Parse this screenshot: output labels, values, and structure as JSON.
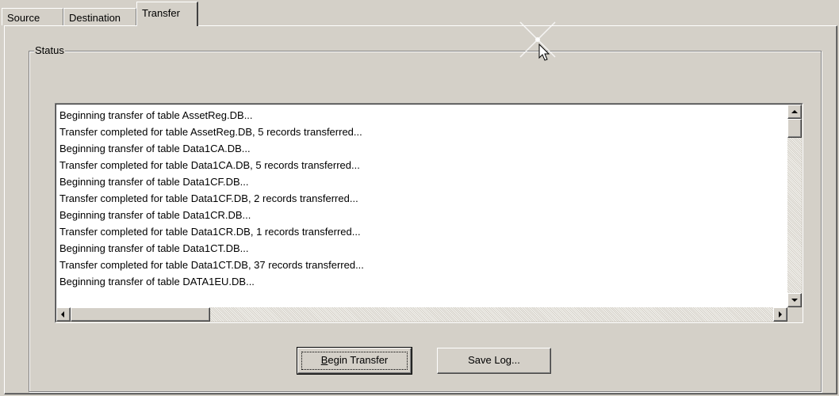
{
  "tabs": [
    {
      "label": "Source"
    },
    {
      "label": "Destination"
    },
    {
      "label": "Transfer"
    }
  ],
  "status_group": {
    "label": "Status"
  },
  "log": {
    "lines": [
      "Beginning transfer of table AssetReg.DB...",
      "Transfer completed for table AssetReg.DB, 5 records transferred...",
      "Beginning transfer of table Data1CA.DB...",
      "Transfer completed for table Data1CA.DB, 5 records transferred...",
      "Beginning transfer of table Data1CF.DB...",
      "Transfer completed for table Data1CF.DB, 2 records transferred...",
      "Beginning transfer of table Data1CR.DB...",
      "Transfer completed for table Data1CR.DB, 1 records transferred...",
      "Beginning transfer of table Data1CT.DB...",
      "Transfer completed for table Data1CT.DB, 37 records transferred...",
      "Beginning transfer of table DATA1EU.DB..."
    ]
  },
  "buttons": {
    "begin_transfer": {
      "accel": "B",
      "rest": "egin Transfer"
    },
    "save_log": "Save Log..."
  },
  "icons": {
    "cursor": "arrow-pointer-icon",
    "scroll_up": "arrow-up-icon",
    "scroll_down": "arrow-down-icon",
    "scroll_left": "arrow-left-icon",
    "scroll_right": "arrow-right-icon"
  },
  "colors": {
    "face": "#d4d0c8",
    "shadow": "#808080",
    "dark_shadow": "#404040",
    "highlight": "#ffffff"
  }
}
